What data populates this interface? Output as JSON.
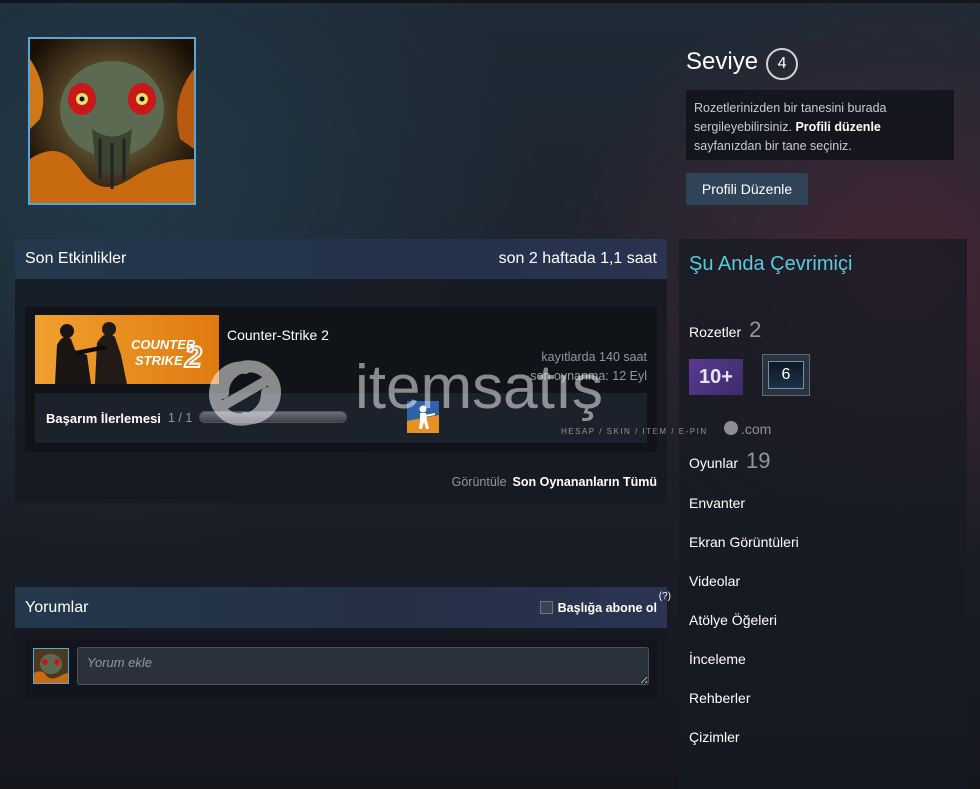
{
  "profile": {
    "level_label": "Seviye",
    "level_value": "4",
    "badge_note_1": "Rozetlerinizden bir tanesini burada sergileyebilirsiniz.",
    "badge_note_link": "Profili düzenle",
    "badge_note_2": "sayfanızdan bir tane seçiniz.",
    "edit_button": "Profili Düzenle"
  },
  "activity": {
    "title": "Son Etkinlikler",
    "summary": "son 2 haftada 1,1 saat",
    "game": {
      "name": "Counter-Strike 2",
      "capsule_line1": "COUNTER",
      "capsule_line2": "STRIKE",
      "capsule_num": "2",
      "hours_total": "kayıtlarda 140 saat",
      "last_played": "son oynanma: 12 Eyl",
      "achievement_label": "Başarım İlerlemesi",
      "achievement_count": "1 / 1",
      "achievement_progress": 1.0
    },
    "view_label": "Görüntüle",
    "view_link": "Son Oynananların Tümü"
  },
  "comments": {
    "title": "Yorumlar",
    "subscribe_label": "Başlığa abone ol",
    "help": "(?)",
    "placeholder": "Yorum ekle"
  },
  "sidebar": {
    "online_status": "Şu Anda Çevrimiçi",
    "badges_label": "Rozetler",
    "badges_count": "2",
    "badge1_text": "10+",
    "badge2_text": "6",
    "games_label": "Oyunlar",
    "games_count": "19",
    "links": [
      "Envanter",
      "Ekran Görüntüleri",
      "Videolar",
      "Atölye Öğeleri",
      "İnceleme",
      "Rehberler",
      "Çizimler"
    ]
  },
  "watermark": {
    "brand": "itemsatış",
    "tagline": "HESAP / SKIN / ITEM / E-PIN",
    "tld": ".com"
  },
  "colors": {
    "accent": "#57cbde",
    "button": "#2f4459",
    "avatar_border": "#5aa6d8"
  }
}
